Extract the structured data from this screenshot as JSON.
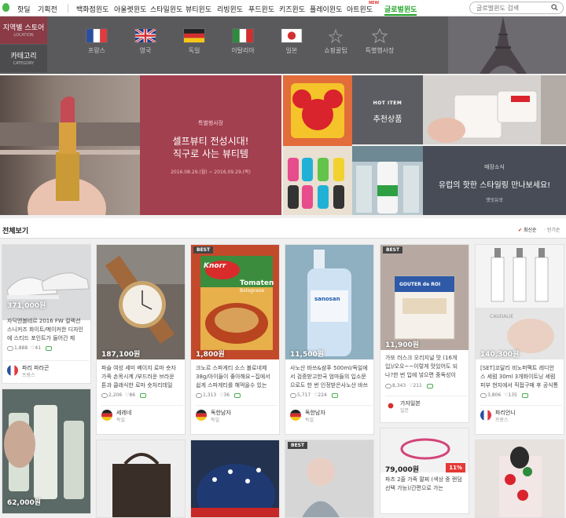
{
  "nav": {
    "items": [
      {
        "label": "핫딜"
      },
      {
        "label": "기획전"
      },
      {
        "label": "백화점윈도"
      },
      {
        "label": "아울렛윈도"
      },
      {
        "label": "스타일윈도"
      },
      {
        "label": "뷰티윈도"
      },
      {
        "label": "리빙윈도"
      },
      {
        "label": "푸드윈도"
      },
      {
        "label": "키즈윈도"
      },
      {
        "label": "플레이윈도"
      },
      {
        "label": "아트윈도"
      },
      {
        "label": "글로벌윈도"
      }
    ],
    "new_badge": "NEW",
    "search_placeholder": "글로벌윈도 검색"
  },
  "categories": {
    "tab_store": {
      "title": "지역별 스토어",
      "sub": "LOCATION"
    },
    "tab_category": {
      "title": "카테고리",
      "sub": "CATEGORY"
    },
    "countries": [
      {
        "label": "프랑스",
        "icon": "france-flag-icon"
      },
      {
        "label": "영국",
        "icon": "uk-flag-icon"
      },
      {
        "label": "독일",
        "icon": "germany-flag-icon"
      },
      {
        "label": "이탈리아",
        "icon": "italy-flag-icon"
      },
      {
        "label": "일본",
        "icon": "japan-flag-icon"
      },
      {
        "label": "쇼핑꿀팁",
        "icon": "sparkle-icon"
      },
      {
        "label": "특별행사장",
        "icon": "star-icon"
      }
    ]
  },
  "hero": {
    "tag": "특별행사장",
    "title_line1": "셀프뷰티 전성시대!",
    "title_line2": "직구로 사는 뷰티템",
    "date": "2016.08.29.(월) ~ 2016.09.29.(목)",
    "hot_item_badge": "HOT ITEM",
    "hot_item_title": "추천상품",
    "store_news_tag": "매장소식",
    "store_news_title": "유럽의 핫한 스타일링 만나보세요!",
    "store_news_sub": "캣잇유로"
  },
  "list": {
    "heading": "전체보기",
    "sort_latest": "최신순",
    "sort_popular": "인기순"
  },
  "products": [
    {
      "price": "371,000원",
      "desc": "자딕앤볼테르 2016 FW 컬렉션 스니커즈 화이트/메이커한 디자인에 스티드 포인트가 들어간 제",
      "views": "1,888",
      "likes": "41",
      "seller": "파리 파라곤",
      "country": "프랑스",
      "best": false
    },
    {
      "price": "187,100원",
      "desc": "파슬 여성 세미 베이지 로마 숏자가죽 손목시계 /부드러운 브라운 톤과 클래식한 로마 숏처리데일",
      "views": "2,206",
      "likes": "86",
      "seller": "세레네",
      "country": "독일",
      "best": false
    },
    {
      "price": "1,800원",
      "desc": "크노르 스파게티 소스 볼로네제 38g/아이들이 좋아해요~집에서 쉽게 스파게티를 해먹을수 있는",
      "views": "1,313",
      "likes": "36",
      "seller": "독한남자",
      "country": "독일",
      "best": true,
      "img_title": "Tomaten",
      "img_sub": "Bolognese",
      "img_brand": "Knorr"
    },
    {
      "price": "11,500원",
      "desc": "사노산 바쓰&샴푸 500ml/독일에서 검증받고한국 엄마들의 입소문으로도 한 번 인정받은사노산 바쓰",
      "views": "5,717",
      "likes": "224",
      "seller": "독한남자",
      "country": "독일",
      "best": false,
      "img_brand": "sanosan"
    },
    {
      "price": "11,900원",
      "desc": "가또 러스크 오리지널 맛 (16개입)/오오~~이렇게 맛있어도 되나?한 번 입에 넣으면 중독성이",
      "views": "8,343",
      "likes": "211",
      "seller": "가자일본",
      "country": "일본",
      "best": true,
      "img_brand": "GOUTER de ROI"
    },
    {
      "price": "140,300원",
      "desc": "[SET]꼬달리 비노퍼펙트 레디언스 세럼 30ml 3개화이트닝 세럼피부 현지에서 직접구매 후 공식통",
      "views": "3,806",
      "likes": "135",
      "seller": "파리언니",
      "country": "프랑스",
      "best": false,
      "img_brand": "CAUDALIE"
    },
    {
      "price": "62,000원",
      "best": false
    },
    {
      "price": "",
      "best": false
    },
    {
      "price": "",
      "best": false
    },
    {
      "price": "",
      "best": true
    },
    {
      "price": "79,000원",
      "desc": "파츠 2줄 가죽 팔찌 (색상 중 랜덤 선택 가능)/간편으로 가는",
      "discount": "11%",
      "best": false
    },
    {
      "price": "",
      "best": false
    }
  ],
  "colors": {
    "accent_green": "#25a52c",
    "tab_active": "#8b3b46",
    "hero_red": "#a3404f",
    "discount_red": "#e53935"
  }
}
